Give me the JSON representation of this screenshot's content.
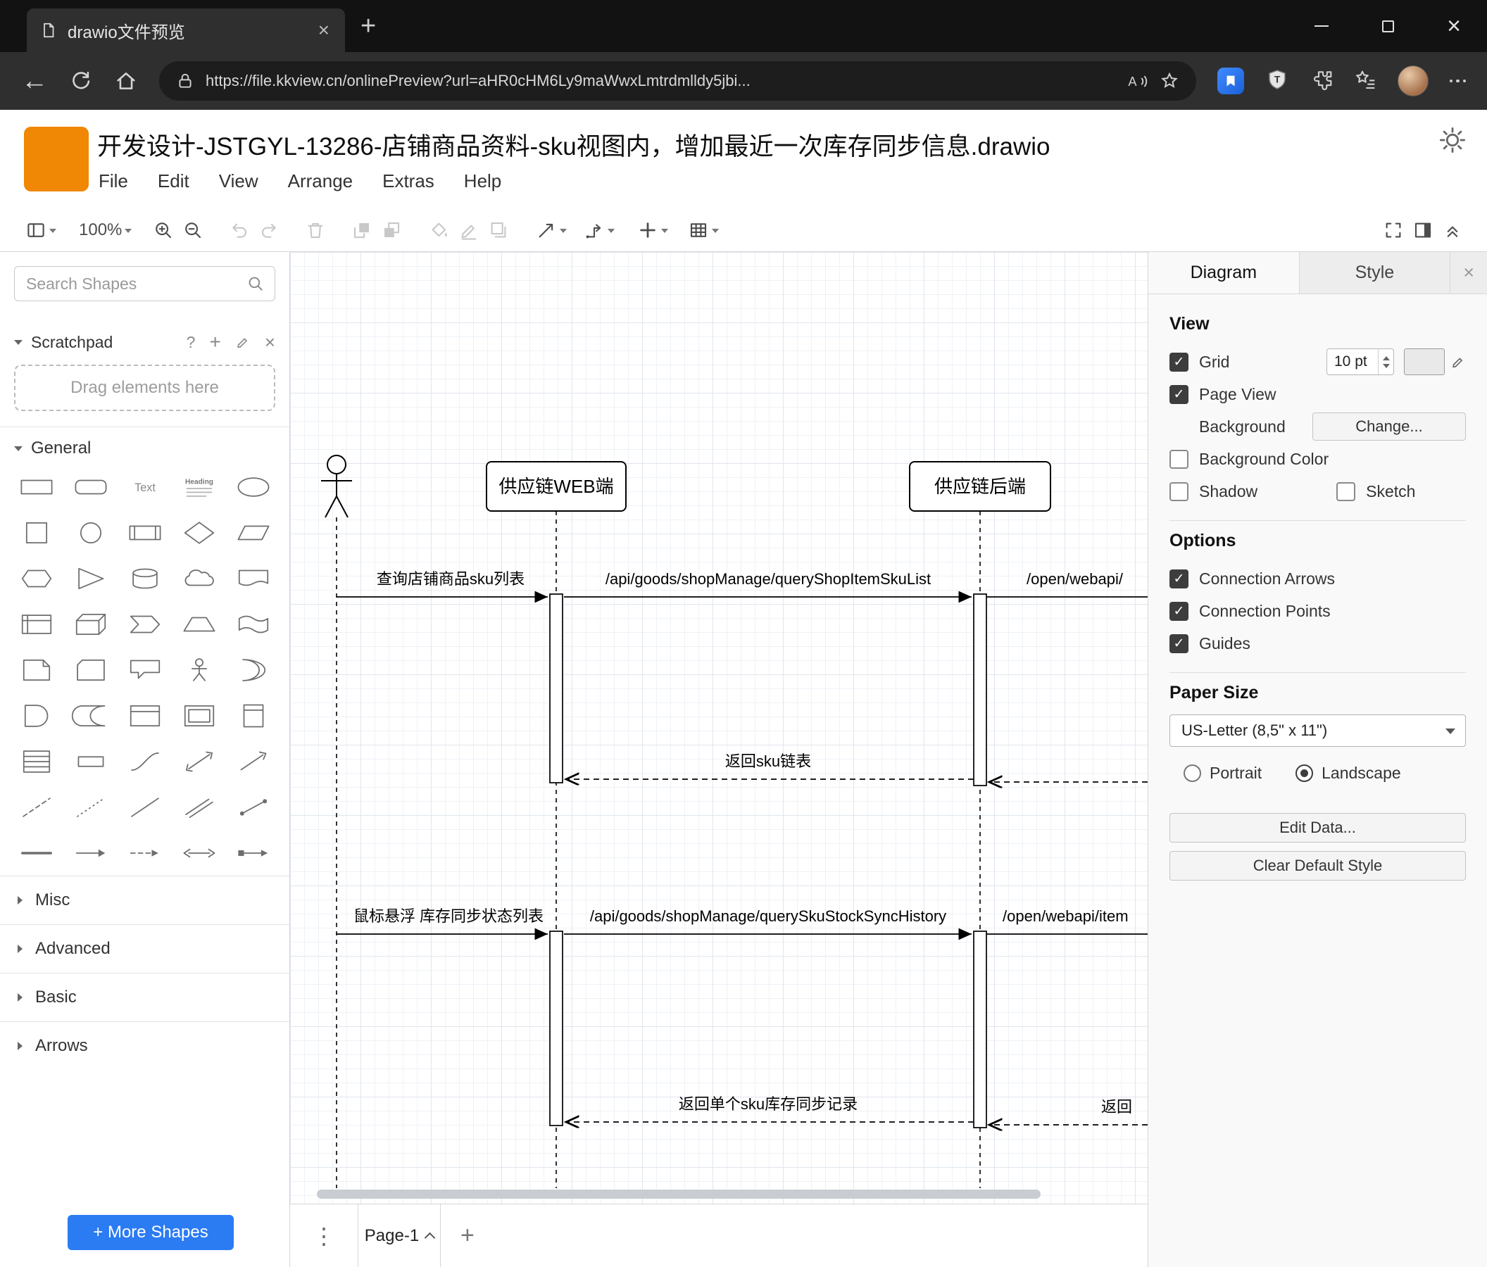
{
  "browser": {
    "tab_title": "drawio文件预览",
    "url": "https://file.kkview.cn/onlinePreview?url=aHR0cHM6Ly9maWwxLmtrdmlldy5jbi..."
  },
  "glyphs": {
    "back_arrow": "←",
    "plus": "+",
    "close": "×",
    "help": "?",
    "vertical_dots": "⋮",
    "check": "✓"
  },
  "app": {
    "title": "开发设计-JSTGYL-13286-店铺商品资料-sku视图内，增加最近一次库存同步信息.drawio",
    "menus": [
      "File",
      "Edit",
      "View",
      "Arrange",
      "Extras",
      "Help"
    ]
  },
  "toolbar": {
    "zoom_level": "100%",
    "items": [
      {
        "name": "page-view",
        "caret": true
      },
      {
        "name": "zoom-level",
        "bind": "toolbar.zoom_level",
        "caret": true,
        "icon": false,
        "gap": 20
      },
      {
        "name": "zoom-in",
        "gap": 18
      },
      {
        "name": "zoom-out"
      },
      {
        "name": "undo",
        "disabled": true,
        "gap": 24
      },
      {
        "name": "redo",
        "disabled": true
      },
      {
        "name": "delete",
        "disabled": true,
        "gap": 24
      },
      {
        "name": "to-front",
        "disabled": true,
        "gap": 24
      },
      {
        "name": "to-back",
        "disabled": true
      },
      {
        "name": "fill-color",
        "disabled": true,
        "gap": 26
      },
      {
        "name": "line-color",
        "disabled": true
      },
      {
        "name": "shadow",
        "disabled": true
      },
      {
        "name": "connection",
        "caret": true,
        "gap": 26
      },
      {
        "name": "waypoints",
        "caret": true,
        "gap": 12
      },
      {
        "name": "insert",
        "caret": true,
        "gap": 20
      },
      {
        "name": "table",
        "caret": true,
        "gap": 16
      },
      {
        "spacer": true
      },
      {
        "name": "fullscreen"
      },
      {
        "name": "format-panel"
      },
      {
        "name": "collapse"
      }
    ]
  },
  "sidebar": {
    "search_placeholder": "Search Shapes",
    "scratchpad_label": "Scratchpad",
    "drag_hint": "Drag elements here",
    "general_label": "General",
    "sections": [
      "Misc",
      "Advanced",
      "Basic",
      "Arrows"
    ],
    "more_shapes_label": "+ More Shapes",
    "shapes": [
      "rectangle",
      "rounded-rectangle",
      "text",
      "heading",
      "ellipse",
      "square",
      "circle",
      "process",
      "diamond",
      "parallelogram",
      "hexagon",
      "triangle",
      "cylinder",
      "cloud",
      "document",
      "internal-storage",
      "cube",
      "step",
      "trapezoid",
      "tape",
      "note",
      "card",
      "callout",
      "actor",
      "or",
      "and",
      "data-storage",
      "container",
      "frame",
      "vertical-container",
      "list",
      "list-item",
      "curve",
      "bidirectional-arrow",
      "arrow",
      "dashed-line",
      "dotted-line",
      "line",
      "diagonal-link",
      "link",
      "horizontal-line",
      "directional-arrow",
      "dashed-directional-arrow",
      "bidirectional-connector",
      "arrow-box"
    ]
  },
  "diagram": {
    "type": "sequence",
    "lifelines": [
      "供应链WEB端",
      "供应链后端"
    ],
    "messages": [
      {
        "label": "查询店铺商品sku列表",
        "kind": "sync"
      },
      {
        "label": "/api/goods/shopManage/queryShopItemSkuList",
        "kind": "sync"
      },
      {
        "label": "/open/webapi/",
        "kind": "sync",
        "clipped": true
      },
      {
        "label": "返回sku链表",
        "kind": "return"
      },
      {
        "label": "鼠标悬浮 库存同步状态列表",
        "kind": "sync"
      },
      {
        "label": "/api/goods/shopManage/querySkuStockSyncHistory",
        "kind": "sync"
      },
      {
        "label": "/open/webapi/item",
        "kind": "sync",
        "clipped": true
      },
      {
        "label": "返回单个sku库存同步记录",
        "kind": "return"
      },
      {
        "label": "返回",
        "kind": "return",
        "clipped": true
      }
    ]
  },
  "panel": {
    "tab_diagram": "Diagram",
    "tab_style": "Style",
    "view_heading": "View",
    "grid_label": "Grid",
    "grid_size": "10 pt",
    "page_view_label": "Page View",
    "background_label": "Background",
    "change_button": "Change...",
    "background_color_label": "Background Color",
    "shadow_label": "Shadow",
    "sketch_label": "Sketch",
    "options_heading": "Options",
    "connection_arrows_label": "Connection Arrows",
    "connection_points_label": "Connection Points",
    "guides_label": "Guides",
    "paper_heading": "Paper Size",
    "paper_size_value": "US-Letter (8,5\" x 11\")",
    "portrait_label": "Portrait",
    "landscape_label": "Landscape",
    "edit_data_button": "Edit Data...",
    "clear_style_button": "Clear Default Style"
  },
  "footer": {
    "page_tab": "Page-1"
  }
}
